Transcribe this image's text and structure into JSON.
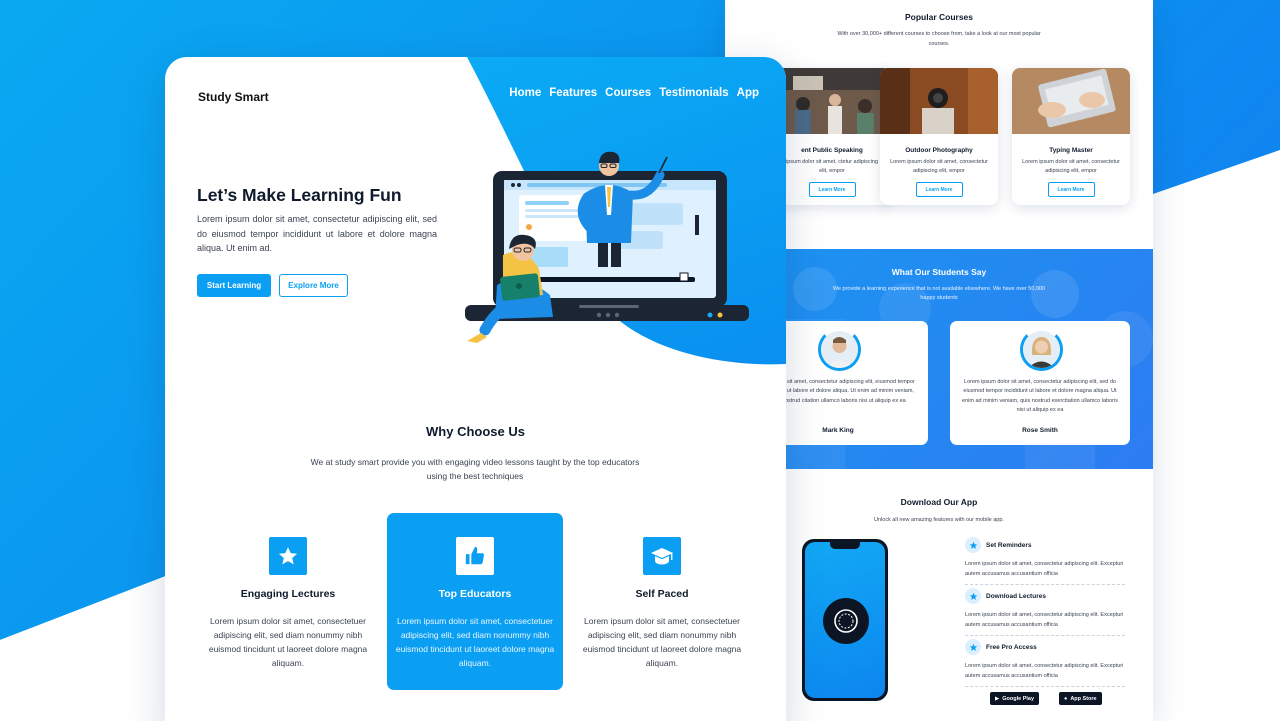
{
  "colors": {
    "accent": "#0a9ff2",
    "dark": "#0f1b2d",
    "text": "#3b4452"
  },
  "landing": {
    "brand": "Study Smart",
    "nav": [
      "Home",
      "Features",
      "Courses",
      "Testimonials",
      "App"
    ],
    "hero": {
      "title": "Let’s Make Learning Fun",
      "text": "Lorem ipsum dolor sit amet, consectetur adipiscing elit, sed do eiusmod tempor incididunt ut labore et dolore magna aliqua. Ut enim ad.",
      "primary_button": "Start Learning",
      "secondary_button": "Explore More"
    },
    "why": {
      "title": "Why Choose Us",
      "subtitle": "We at study smart provide you with engaging video lessons taught by the top educators using the best techniques",
      "features": [
        {
          "title": "Engaging Lectures",
          "icon": "star-icon",
          "text": "Lorem ipsum dolor sit amet, consectetuer adipiscing elit, sed diam nonummy nibh euismod tincidunt ut laoreet dolore magna aliquam."
        },
        {
          "title": "Top Educators",
          "icon": "thumbs-up-icon",
          "text": "Lorem ipsum dolor sit amet, consectetuer adipiscing elit, sed diam nonummy nibh euismod tincidunt ut laoreet dolore magna aliquam."
        },
        {
          "title": "Self Paced",
          "icon": "graduation-cap-icon",
          "text": "Lorem ipsum dolor sit amet, consectetuer adipiscing elit, sed diam nonummy nibh euismod tincidunt ut laoreet dolore magna aliquam."
        }
      ]
    }
  },
  "right_page": {
    "popular": {
      "title": "Popular Courses",
      "subtitle": "With over 30,000+ different courses to choose from, take a look at our most popular courses.",
      "courses": [
        {
          "name": "ent Public Speaking",
          "text": "ipsum dolor sit amet, ctetur adipiscing elit, empor",
          "button": "Learn More"
        },
        {
          "name": "Outdoor Photography",
          "text": "Lorem ipsum dolor sit amet, consectetur adipiscing elit, empor",
          "button": "Learn More"
        },
        {
          "name": "Typing Master",
          "text": "Lorem ipsum dolor sit amet, consectetur adipiscing elit, empor",
          "button": "Learn More"
        }
      ]
    },
    "testimonials": {
      "title": "What Our Students Say",
      "subtitle": "We provide a learning experience that is not available elsewhere. We have over 50,000 happy students",
      "items": [
        {
          "name": "Mark King",
          "text": "sum dolor sit amet, consectetur adipiscing elit, eiusmod tempor incididunt ut labore et dolore aliqua. Ut enim ad minim veniam, quis nostrud citation ullamco laboris nisi ut aliquip ex ea"
        },
        {
          "name": "Rose Smith",
          "text": "Lorem ipsum dolor sit amet, consectetur adipiscing elit, sed do eiusmod tempor incididunt ut labore et dolore magna aliqua. Ut enim ad minim veniam, quis nostrud exercitation ullamco laboris nisi ut aliquip ex ea"
        }
      ]
    },
    "app": {
      "title": "Download Our App",
      "subtitle": "Unlock all new amazing features with our mobile app.",
      "items": [
        {
          "title": "Set Reminders",
          "text": "Lorem ipsum dolor sit amet, consectetur adipiscing elit. Excepturi autem accusamus accusantium officia"
        },
        {
          "title": "Download Lectures",
          "text": "Lorem ipsum dolor sit amet, consectetur adipiscing elit. Excepturi autem accusamus accusantium officia"
        },
        {
          "title": "Free Pro Access",
          "text": "Lorem ipsum dolor sit amet, consectetur adipiscing elit. Excepturi autem accusamus accusantium officia"
        }
      ],
      "badges": [
        "Google Play",
        "App Store"
      ]
    }
  }
}
